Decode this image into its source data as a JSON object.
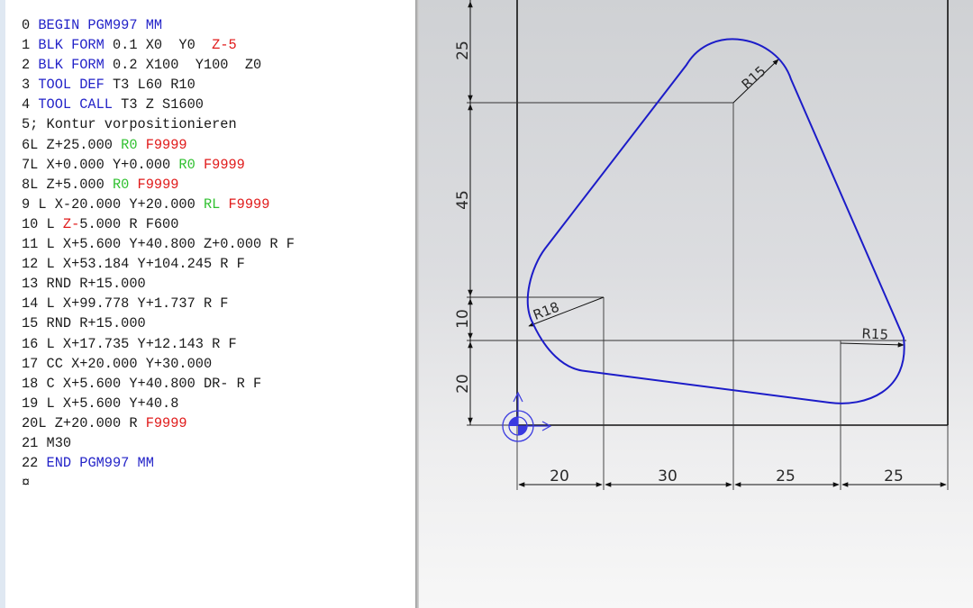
{
  "editor": {
    "lines": [
      [
        {
          "t": "0 "
        },
        {
          "t": "BEGIN PGM997 MM",
          "c": "blue"
        }
      ],
      [
        {
          "t": "1 "
        },
        {
          "t": "BLK FORM",
          "c": "blue"
        },
        {
          "t": " 0.1 X0  Y0  "
        },
        {
          "t": "Z-5",
          "c": "red"
        }
      ],
      [
        {
          "t": "2 "
        },
        {
          "t": "BLK FORM",
          "c": "blue"
        },
        {
          "t": " 0.2 X100  Y100  Z0"
        }
      ],
      [
        {
          "t": "3 "
        },
        {
          "t": "TOOL DEF",
          "c": "blue"
        },
        {
          "t": " T3 L60 R10"
        }
      ],
      [
        {
          "t": "4 "
        },
        {
          "t": "TOOL CALL",
          "c": "blue"
        },
        {
          "t": " T3 Z S1600"
        }
      ],
      [
        {
          "t": "5; Kontur vorpositionieren"
        }
      ],
      [
        {
          "t": "6L Z+25.000 "
        },
        {
          "t": "R0",
          "c": "green"
        },
        {
          "t": " "
        },
        {
          "t": "F9999",
          "c": "red"
        }
      ],
      [
        {
          "t": "7L X+0.000 Y+0.000 "
        },
        {
          "t": "R0",
          "c": "green"
        },
        {
          "t": " "
        },
        {
          "t": "F9999",
          "c": "red"
        }
      ],
      [
        {
          "t": "8L Z+5.000 "
        },
        {
          "t": "R0",
          "c": "green"
        },
        {
          "t": " "
        },
        {
          "t": "F9999",
          "c": "red"
        }
      ],
      [
        {
          "t": "9 L X-20.000 Y+20.000 "
        },
        {
          "t": "RL",
          "c": "green"
        },
        {
          "t": " "
        },
        {
          "t": "F9999",
          "c": "red"
        }
      ],
      [
        {
          "t": "10 L "
        },
        {
          "t": "Z-",
          "c": "red"
        },
        {
          "t": "5.000 R F600"
        }
      ],
      [
        {
          "t": "11 L X+5.600 Y+40.800 Z+0.000 R F"
        }
      ],
      [
        {
          "t": "12 L X+53.184 Y+104.245 R F"
        }
      ],
      [
        {
          "t": "13 RND R+15.000"
        }
      ],
      [
        {
          "t": "14 L X+99.778 Y+1.737 R F"
        }
      ],
      [
        {
          "t": "15 RND R+15.000"
        }
      ],
      [
        {
          "t": "16 L X+17.735 Y+12.143 R F"
        }
      ],
      [
        {
          "t": "17 CC X+20.000 Y+30.000"
        }
      ],
      [
        {
          "t": "18 C X+5.600 Y+40.800 DR- R F"
        }
      ],
      [
        {
          "t": "19 L X+5.600 Y+40.8"
        }
      ],
      [
        {
          "t": "20L Z+20.000 R "
        },
        {
          "t": "F9999",
          "c": "red"
        }
      ],
      [
        {
          "t": "21 M30"
        }
      ],
      [
        {
          "t": "22 "
        },
        {
          "t": "END PGM997 MM",
          "c": "blue"
        }
      ],
      [
        {
          "t": "¤"
        }
      ]
    ]
  },
  "drawing": {
    "dims_vertical": [
      "25",
      "45",
      "10",
      "20"
    ],
    "dims_horizontal": [
      "20",
      "30",
      "25",
      "25"
    ],
    "radii": [
      "R15",
      "R18",
      "R15"
    ],
    "colors": {
      "contour": "#1c1cc8",
      "lines": "#111111",
      "origin_symbol": "#3a3ae0",
      "background_top": "#cfd1d4",
      "background_bottom": "#f7f7f7"
    },
    "icons": [
      "datum-origin-icon"
    ]
  }
}
